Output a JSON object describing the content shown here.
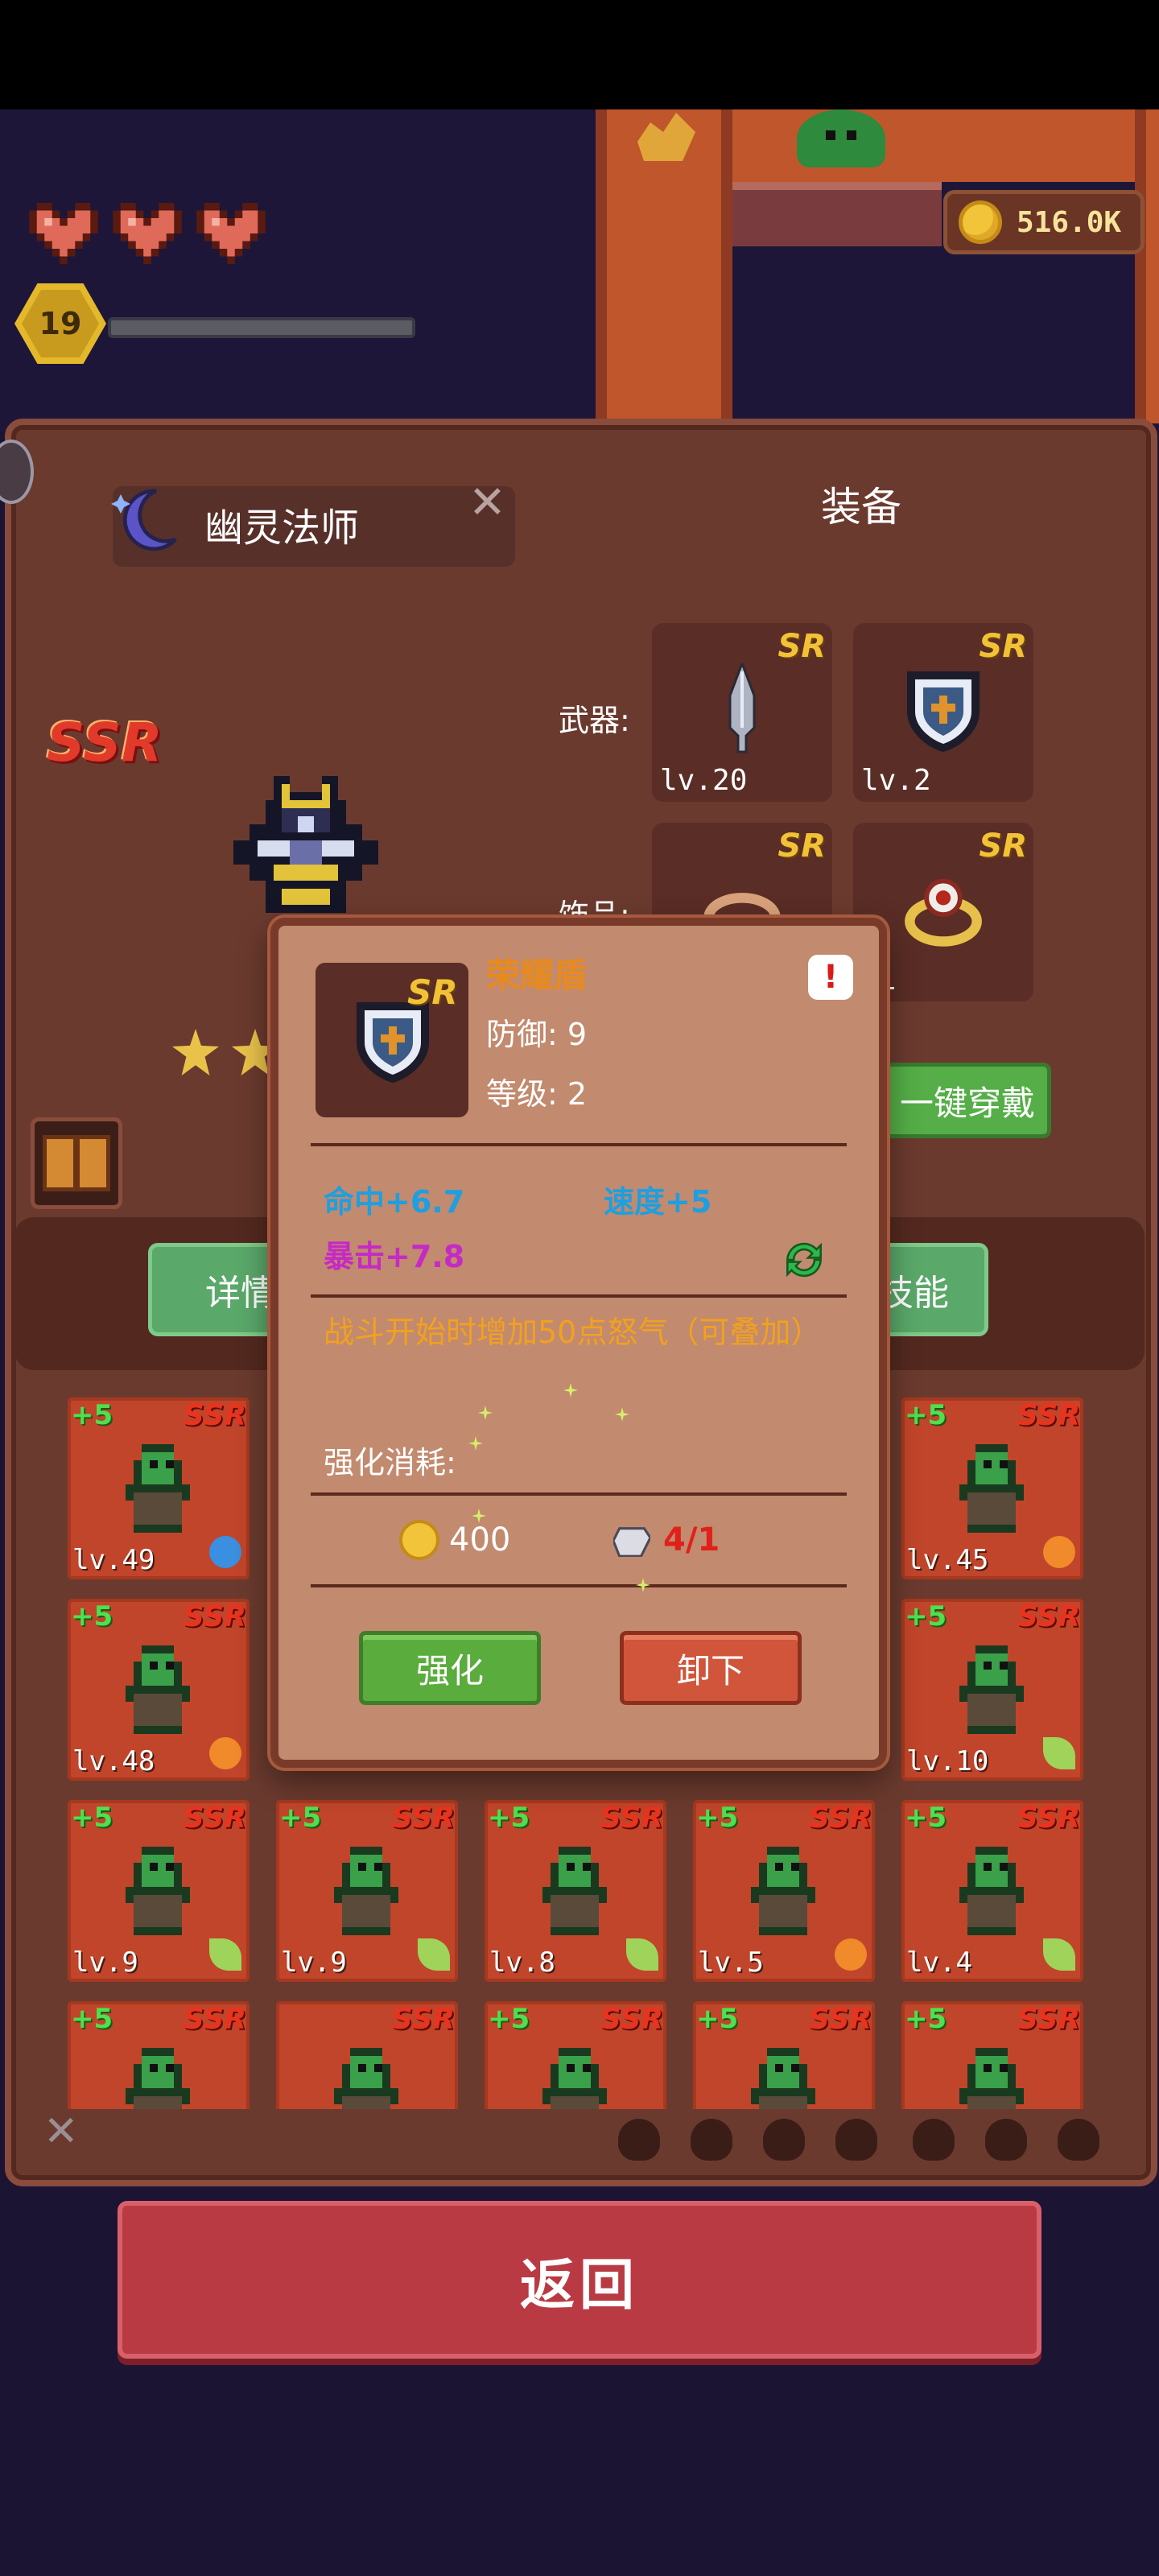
{
  "hud": {
    "level": "19",
    "coins": "516.0K",
    "hearts": 3,
    "xp_fraction": 0.0
  },
  "character": {
    "name": "幽灵法师",
    "rarity": "SSR",
    "stars": 2
  },
  "equipment": {
    "title": "装备",
    "weapon_label": "武器:",
    "accessory_label": "饰品:",
    "slots": [
      {
        "rarity": "SR",
        "level": "lv.20",
        "icon": "dagger-icon"
      },
      {
        "rarity": "SR",
        "level": "lv.2",
        "icon": "shield-icon"
      },
      {
        "rarity": "SR",
        "level": "",
        "icon": "bracelet-icon"
      },
      {
        "rarity": "SR",
        "level": ".1",
        "icon": "ring-icon"
      }
    ],
    "one_click_wear": "一键穿戴"
  },
  "tabs": {
    "details": "详情",
    "skills": "技能"
  },
  "popup": {
    "item_name": "荣耀盾",
    "rarity": "SR",
    "defense": "防御: 9",
    "level": "等级: 2",
    "alert": "!",
    "hit": "命中+6.7",
    "speed": "速度+5",
    "crit": "暴击+7.8",
    "description": "战斗开始时增加50点怒气（可叠加）",
    "cost_label": "强化消耗:",
    "cost_coins": "400",
    "cost_stones": "4/1",
    "enhance_button": "强化",
    "unequip_button": "卸下",
    "colors": {
      "name": "#e98a1c",
      "hit": "#1e9fe0",
      "speed": "#1e9fe0",
      "crit": "#c62ac4",
      "desc": "#f2a11e",
      "stone_cost": "#e0201a"
    }
  },
  "units": [
    {
      "plus": "+5",
      "rarity": "SSR",
      "level": "lv.49",
      "elem": "water"
    },
    {
      "plus": "+5",
      "rarity": "SSR",
      "level": "lv.45",
      "elem": "sun"
    },
    {
      "plus": "+5",
      "rarity": "SSR",
      "level": "lv.48",
      "elem": "sun"
    },
    {
      "plus": "+5",
      "rarity": "SSR",
      "level": "lv.10",
      "elem": "leaf"
    },
    {
      "plus": "+5",
      "rarity": "SSR",
      "level": "lv.9",
      "elem": "leaf"
    },
    {
      "plus": "+5",
      "rarity": "SSR",
      "level": "lv.9",
      "elem": "leaf"
    },
    {
      "plus": "+5",
      "rarity": "SSR",
      "level": "lv.8",
      "elem": "leaf"
    },
    {
      "plus": "+5",
      "rarity": "SSR",
      "level": "lv.5",
      "elem": "sun"
    },
    {
      "plus": "+5",
      "rarity": "SSR",
      "level": "lv.4",
      "elem": "leaf"
    },
    {
      "plus": "+5",
      "rarity": "SSR",
      "level": "",
      "elem": ""
    },
    {
      "plus": "",
      "rarity": "SSR",
      "level": "",
      "elem": ""
    },
    {
      "plus": "+5",
      "rarity": "SSR",
      "level": "",
      "elem": ""
    },
    {
      "plus": "+5",
      "rarity": "SSR",
      "level": "",
      "elem": ""
    },
    {
      "plus": "+5",
      "rarity": "SSR",
      "level": "",
      "elem": ""
    }
  ],
  "return_button": "返回"
}
